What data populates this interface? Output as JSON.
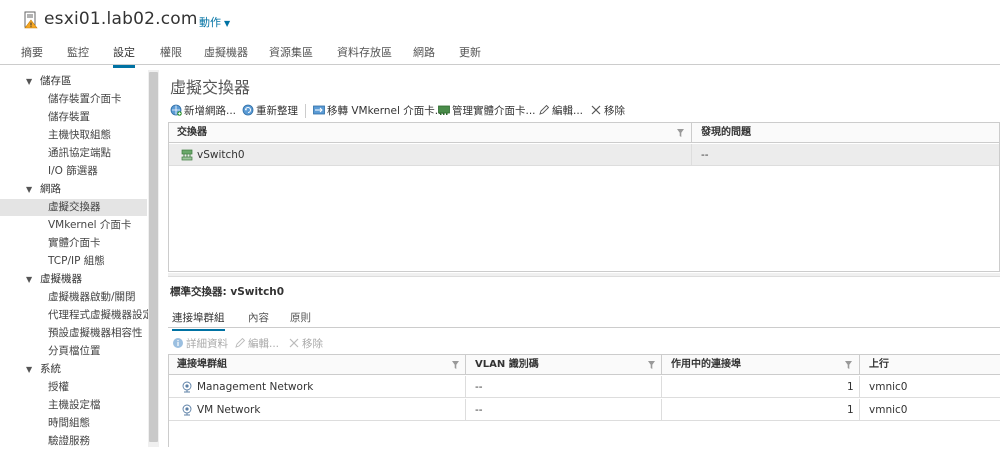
{
  "header": {
    "host_name": "esxi01.lab02.com",
    "actions_label": "動作"
  },
  "tabs": [
    {
      "label": "摘要"
    },
    {
      "label": "監控"
    },
    {
      "label": "設定",
      "active": true
    },
    {
      "label": "權限"
    },
    {
      "label": "虛擬機器"
    },
    {
      "label": "資源集區"
    },
    {
      "label": "資料存放區"
    },
    {
      "label": "網路"
    },
    {
      "label": "更新"
    }
  ],
  "nav": {
    "groups": [
      {
        "label": "儲存區",
        "children": [
          "儲存裝置介面卡",
          "儲存裝置",
          "主機快取組態",
          "通訊協定端點",
          "I/O 篩選器"
        ]
      },
      {
        "label": "網路",
        "children": [
          "虛擬交換器",
          "VMkernel 介面卡",
          "實體介面卡",
          "TCP/IP 組態"
        ]
      },
      {
        "label": "虛擬機器",
        "children": [
          "虛擬機器啟動/關閉",
          "代理程式虛擬機器設定",
          "預設虛擬機器相容性",
          "分頁檔位置"
        ]
      },
      {
        "label": "系統",
        "children": [
          "授權",
          "主機設定檔",
          "時間組態",
          "驗證服務"
        ]
      }
    ],
    "selected": "虛擬交換器"
  },
  "main": {
    "title": "虛擬交換器",
    "toolbar": {
      "add_network": "新增網路...",
      "refresh": "重新整理",
      "migrate_vmk": "移轉 VMkernel 介面卡...",
      "manage_nics": "管理實體介面卡...",
      "edit": "編輯...",
      "remove": "移除"
    },
    "switch_grid": {
      "columns": [
        "交換器",
        "發現的問題"
      ],
      "rows": [
        {
          "name": "vSwitch0",
          "issues": "--"
        }
      ]
    },
    "detail": {
      "title": "標準交換器: vSwitch0",
      "tabs": [
        "連接埠群組",
        "內容",
        "原則"
      ],
      "toolbar": {
        "details": "詳細資料",
        "edit": "編輯...",
        "remove": "移除"
      },
      "grid": {
        "columns": [
          "連接埠群組",
          "VLAN 識別碼",
          "作用中的連接埠",
          "上行"
        ],
        "rows": [
          {
            "name": "Management Network",
            "vlan": "--",
            "active_ports": "1",
            "uplink": "vmnic0"
          },
          {
            "name": "VM Network",
            "vlan": "--",
            "active_ports": "1",
            "uplink": "vmnic0"
          }
        ]
      }
    }
  },
  "colors": {
    "accent": "#0072a3",
    "selected_row": "#ececec",
    "warning": "#f5a623"
  }
}
